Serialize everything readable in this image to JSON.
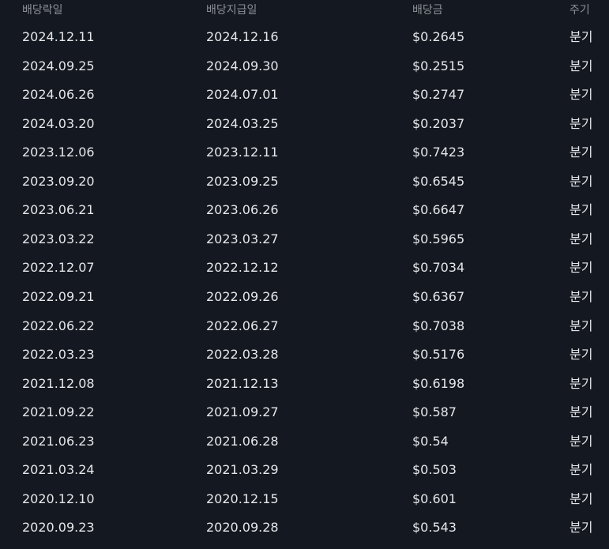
{
  "table": {
    "headers": {
      "ex_date": "배당락일",
      "pay_date": "배당지급일",
      "amount": "배당금",
      "cycle": "주기"
    },
    "rows": [
      {
        "ex_date": "2024.12.11",
        "pay_date": "2024.12.16",
        "amount": "$0.2645",
        "cycle": "분기"
      },
      {
        "ex_date": "2024.09.25",
        "pay_date": "2024.09.30",
        "amount": "$0.2515",
        "cycle": "분기"
      },
      {
        "ex_date": "2024.06.26",
        "pay_date": "2024.07.01",
        "amount": "$0.2747",
        "cycle": "분기"
      },
      {
        "ex_date": "2024.03.20",
        "pay_date": "2024.03.25",
        "amount": "$0.2037",
        "cycle": "분기"
      },
      {
        "ex_date": "2023.12.06",
        "pay_date": "2023.12.11",
        "amount": "$0.7423",
        "cycle": "분기"
      },
      {
        "ex_date": "2023.09.20",
        "pay_date": "2023.09.25",
        "amount": "$0.6545",
        "cycle": "분기"
      },
      {
        "ex_date": "2023.06.21",
        "pay_date": "2023.06.26",
        "amount": "$0.6647",
        "cycle": "분기"
      },
      {
        "ex_date": "2023.03.22",
        "pay_date": "2023.03.27",
        "amount": "$0.5965",
        "cycle": "분기"
      },
      {
        "ex_date": "2022.12.07",
        "pay_date": "2022.12.12",
        "amount": "$0.7034",
        "cycle": "분기"
      },
      {
        "ex_date": "2022.09.21",
        "pay_date": "2022.09.26",
        "amount": "$0.6367",
        "cycle": "분기"
      },
      {
        "ex_date": "2022.06.22",
        "pay_date": "2022.06.27",
        "amount": "$0.7038",
        "cycle": "분기"
      },
      {
        "ex_date": "2022.03.23",
        "pay_date": "2022.03.28",
        "amount": "$0.5176",
        "cycle": "분기"
      },
      {
        "ex_date": "2021.12.08",
        "pay_date": "2021.12.13",
        "amount": "$0.6198",
        "cycle": "분기"
      },
      {
        "ex_date": "2021.09.22",
        "pay_date": "2021.09.27",
        "amount": "$0.587",
        "cycle": "분기"
      },
      {
        "ex_date": "2021.06.23",
        "pay_date": "2021.06.28",
        "amount": "$0.54",
        "cycle": "분기"
      },
      {
        "ex_date": "2021.03.24",
        "pay_date": "2021.03.29",
        "amount": "$0.503",
        "cycle": "분기"
      },
      {
        "ex_date": "2020.12.10",
        "pay_date": "2020.12.15",
        "amount": "$0.601",
        "cycle": "분기"
      },
      {
        "ex_date": "2020.09.23",
        "pay_date": "2020.09.28",
        "amount": "$0.543",
        "cycle": "분기"
      }
    ]
  },
  "colors": {
    "background": "#141820",
    "header_text": "#8c8f96",
    "cell_text": "#e6e7ea"
  }
}
